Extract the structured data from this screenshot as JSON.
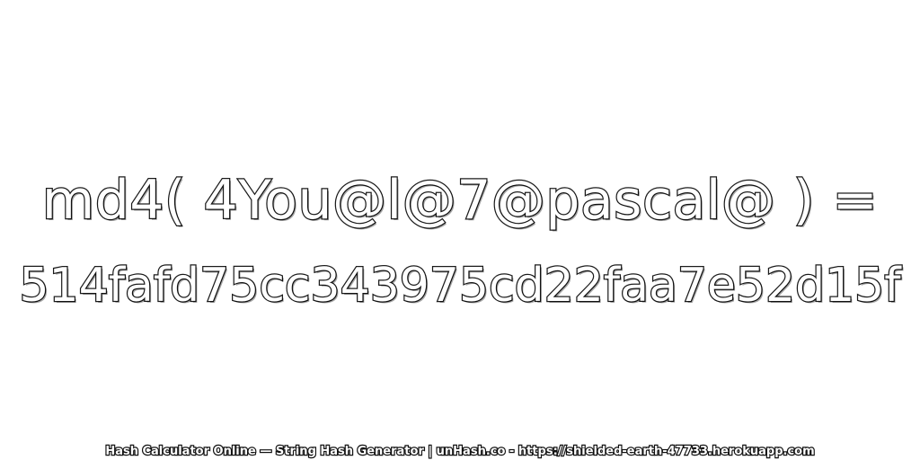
{
  "expression": "md4( 4You@l@7@pascal@ ) =",
  "hash": "514fafd75cc343975cd22faa7e52d15f",
  "footer": "Hash Calculator Online — String Hash Generator | unHash.co - https://shielded-earth-47733.herokuapp.com"
}
